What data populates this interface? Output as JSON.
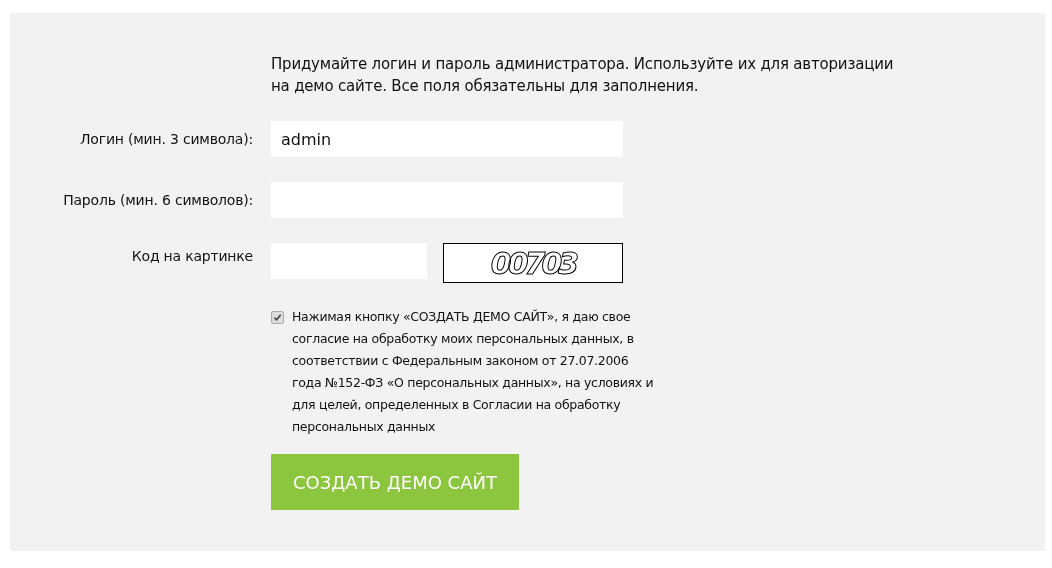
{
  "intro": "Придумайте логин и пароль администратора. Используйте их для авторизации на демо сайте. Все поля обязательны для заполнения.",
  "fields": [
    {
      "label": "Логин (мин. 3 символа):",
      "value": "admin",
      "kind": "text"
    },
    {
      "label": "Пароль (мин. 6 символов):",
      "kind": "password"
    },
    {
      "label": "Код на картинке",
      "kind": "captcha",
      "captcha": "00703"
    }
  ],
  "consent": {
    "checked": true,
    "text": "Нажимая кнопку «СОЗДАТЬ ДЕМО САЙТ», я даю свое согласие на обработку моих персональных данных, в соответствии с Федеральным законом от 27.07.2006 года №152-ФЗ «О персональных данных», на условиях и для целей, определенных в Согласии на обработку персональных данных"
  },
  "submit_button": "СОЗДАТЬ ДЕМО САЙТ"
}
